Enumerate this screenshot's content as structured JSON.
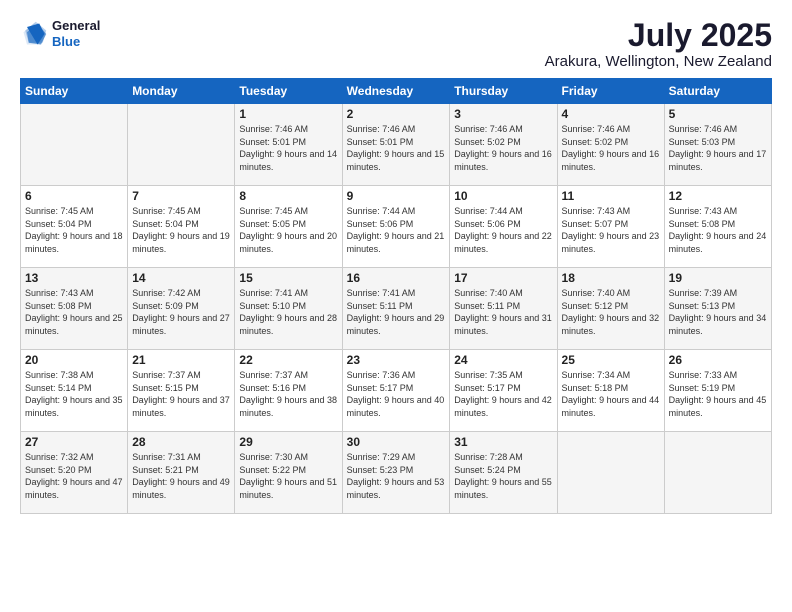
{
  "logo": {
    "general": "General",
    "blue": "Blue"
  },
  "header": {
    "month": "July 2025",
    "location": "Arakura, Wellington, New Zealand"
  },
  "weekdays": [
    "Sunday",
    "Monday",
    "Tuesday",
    "Wednesday",
    "Thursday",
    "Friday",
    "Saturday"
  ],
  "weeks": [
    [
      {
        "day": "",
        "sunrise": "",
        "sunset": "",
        "daylight": ""
      },
      {
        "day": "",
        "sunrise": "",
        "sunset": "",
        "daylight": ""
      },
      {
        "day": "1",
        "sunrise": "Sunrise: 7:46 AM",
        "sunset": "Sunset: 5:01 PM",
        "daylight": "Daylight: 9 hours and 14 minutes."
      },
      {
        "day": "2",
        "sunrise": "Sunrise: 7:46 AM",
        "sunset": "Sunset: 5:01 PM",
        "daylight": "Daylight: 9 hours and 15 minutes."
      },
      {
        "day": "3",
        "sunrise": "Sunrise: 7:46 AM",
        "sunset": "Sunset: 5:02 PM",
        "daylight": "Daylight: 9 hours and 16 minutes."
      },
      {
        "day": "4",
        "sunrise": "Sunrise: 7:46 AM",
        "sunset": "Sunset: 5:02 PM",
        "daylight": "Daylight: 9 hours and 16 minutes."
      },
      {
        "day": "5",
        "sunrise": "Sunrise: 7:46 AM",
        "sunset": "Sunset: 5:03 PM",
        "daylight": "Daylight: 9 hours and 17 minutes."
      }
    ],
    [
      {
        "day": "6",
        "sunrise": "Sunrise: 7:45 AM",
        "sunset": "Sunset: 5:04 PM",
        "daylight": "Daylight: 9 hours and 18 minutes."
      },
      {
        "day": "7",
        "sunrise": "Sunrise: 7:45 AM",
        "sunset": "Sunset: 5:04 PM",
        "daylight": "Daylight: 9 hours and 19 minutes."
      },
      {
        "day": "8",
        "sunrise": "Sunrise: 7:45 AM",
        "sunset": "Sunset: 5:05 PM",
        "daylight": "Daylight: 9 hours and 20 minutes."
      },
      {
        "day": "9",
        "sunrise": "Sunrise: 7:44 AM",
        "sunset": "Sunset: 5:06 PM",
        "daylight": "Daylight: 9 hours and 21 minutes."
      },
      {
        "day": "10",
        "sunrise": "Sunrise: 7:44 AM",
        "sunset": "Sunset: 5:06 PM",
        "daylight": "Daylight: 9 hours and 22 minutes."
      },
      {
        "day": "11",
        "sunrise": "Sunrise: 7:43 AM",
        "sunset": "Sunset: 5:07 PM",
        "daylight": "Daylight: 9 hours and 23 minutes."
      },
      {
        "day": "12",
        "sunrise": "Sunrise: 7:43 AM",
        "sunset": "Sunset: 5:08 PM",
        "daylight": "Daylight: 9 hours and 24 minutes."
      }
    ],
    [
      {
        "day": "13",
        "sunrise": "Sunrise: 7:43 AM",
        "sunset": "Sunset: 5:08 PM",
        "daylight": "Daylight: 9 hours and 25 minutes."
      },
      {
        "day": "14",
        "sunrise": "Sunrise: 7:42 AM",
        "sunset": "Sunset: 5:09 PM",
        "daylight": "Daylight: 9 hours and 27 minutes."
      },
      {
        "day": "15",
        "sunrise": "Sunrise: 7:41 AM",
        "sunset": "Sunset: 5:10 PM",
        "daylight": "Daylight: 9 hours and 28 minutes."
      },
      {
        "day": "16",
        "sunrise": "Sunrise: 7:41 AM",
        "sunset": "Sunset: 5:11 PM",
        "daylight": "Daylight: 9 hours and 29 minutes."
      },
      {
        "day": "17",
        "sunrise": "Sunrise: 7:40 AM",
        "sunset": "Sunset: 5:11 PM",
        "daylight": "Daylight: 9 hours and 31 minutes."
      },
      {
        "day": "18",
        "sunrise": "Sunrise: 7:40 AM",
        "sunset": "Sunset: 5:12 PM",
        "daylight": "Daylight: 9 hours and 32 minutes."
      },
      {
        "day": "19",
        "sunrise": "Sunrise: 7:39 AM",
        "sunset": "Sunset: 5:13 PM",
        "daylight": "Daylight: 9 hours and 34 minutes."
      }
    ],
    [
      {
        "day": "20",
        "sunrise": "Sunrise: 7:38 AM",
        "sunset": "Sunset: 5:14 PM",
        "daylight": "Daylight: 9 hours and 35 minutes."
      },
      {
        "day": "21",
        "sunrise": "Sunrise: 7:37 AM",
        "sunset": "Sunset: 5:15 PM",
        "daylight": "Daylight: 9 hours and 37 minutes."
      },
      {
        "day": "22",
        "sunrise": "Sunrise: 7:37 AM",
        "sunset": "Sunset: 5:16 PM",
        "daylight": "Daylight: 9 hours and 38 minutes."
      },
      {
        "day": "23",
        "sunrise": "Sunrise: 7:36 AM",
        "sunset": "Sunset: 5:17 PM",
        "daylight": "Daylight: 9 hours and 40 minutes."
      },
      {
        "day": "24",
        "sunrise": "Sunrise: 7:35 AM",
        "sunset": "Sunset: 5:17 PM",
        "daylight": "Daylight: 9 hours and 42 minutes."
      },
      {
        "day": "25",
        "sunrise": "Sunrise: 7:34 AM",
        "sunset": "Sunset: 5:18 PM",
        "daylight": "Daylight: 9 hours and 44 minutes."
      },
      {
        "day": "26",
        "sunrise": "Sunrise: 7:33 AM",
        "sunset": "Sunset: 5:19 PM",
        "daylight": "Daylight: 9 hours and 45 minutes."
      }
    ],
    [
      {
        "day": "27",
        "sunrise": "Sunrise: 7:32 AM",
        "sunset": "Sunset: 5:20 PM",
        "daylight": "Daylight: 9 hours and 47 minutes."
      },
      {
        "day": "28",
        "sunrise": "Sunrise: 7:31 AM",
        "sunset": "Sunset: 5:21 PM",
        "daylight": "Daylight: 9 hours and 49 minutes."
      },
      {
        "day": "29",
        "sunrise": "Sunrise: 7:30 AM",
        "sunset": "Sunset: 5:22 PM",
        "daylight": "Daylight: 9 hours and 51 minutes."
      },
      {
        "day": "30",
        "sunrise": "Sunrise: 7:29 AM",
        "sunset": "Sunset: 5:23 PM",
        "daylight": "Daylight: 9 hours and 53 minutes."
      },
      {
        "day": "31",
        "sunrise": "Sunrise: 7:28 AM",
        "sunset": "Sunset: 5:24 PM",
        "daylight": "Daylight: 9 hours and 55 minutes."
      },
      {
        "day": "",
        "sunrise": "",
        "sunset": "",
        "daylight": ""
      },
      {
        "day": "",
        "sunrise": "",
        "sunset": "",
        "daylight": ""
      }
    ]
  ]
}
